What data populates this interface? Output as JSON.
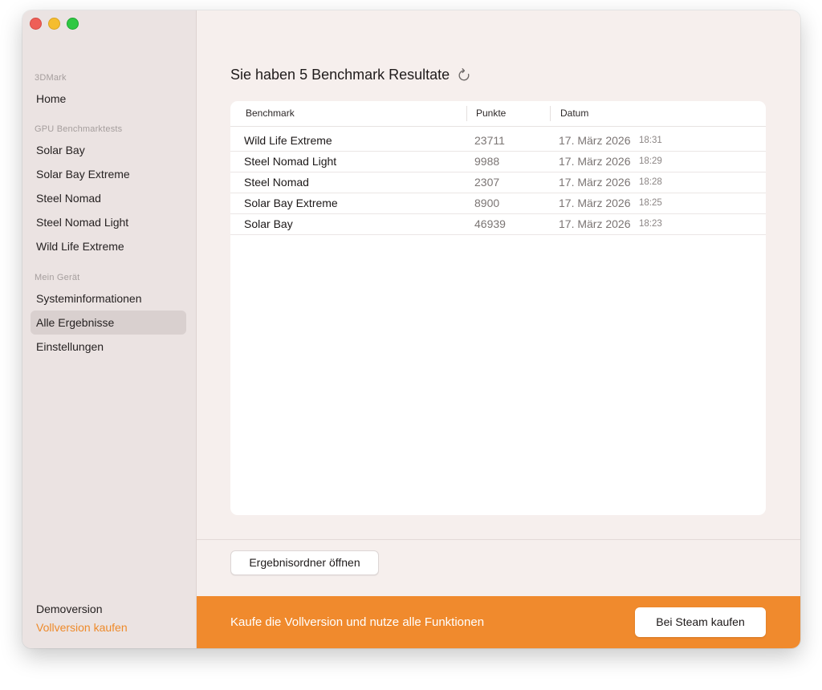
{
  "window": {
    "controls": [
      "close",
      "minimize",
      "zoom"
    ]
  },
  "sidebar": {
    "app_section": "3DMark",
    "home_label": "Home",
    "gpu_section": "GPU Benchmarktests",
    "gpu_items": [
      {
        "label": "Solar Bay"
      },
      {
        "label": "Solar Bay Extreme"
      },
      {
        "label": "Steel Nomad"
      },
      {
        "label": "Steel Nomad Light"
      },
      {
        "label": "Wild Life Extreme"
      }
    ],
    "device_section": "Mein Gerät",
    "device_items": [
      {
        "label": "Systeminformationen",
        "active": false
      },
      {
        "label": "Alle Ergebnisse",
        "active": true
      },
      {
        "label": "Einstellungen",
        "active": false
      }
    ],
    "demo_label": "Demoversion",
    "buy_label": "Vollversion kaufen"
  },
  "main": {
    "title": "Sie haben 5 Benchmark Resultate",
    "refresh_icon": "refresh-icon",
    "table": {
      "columns": [
        "Benchmark",
        "Punkte",
        "Datum"
      ],
      "rows": [
        {
          "benchmark": "Wild Life Extreme",
          "score": "23711",
          "date": "17. März 2026",
          "time": "18:31"
        },
        {
          "benchmark": "Steel Nomad Light",
          "score": "9988",
          "date": "17. März 2026",
          "time": "18:29"
        },
        {
          "benchmark": "Steel Nomad",
          "score": "2307",
          "date": "17. März 2026",
          "time": "18:28"
        },
        {
          "benchmark": "Solar Bay Extreme",
          "score": "8900",
          "date": "17. März 2026",
          "time": "18:25"
        },
        {
          "benchmark": "Solar Bay",
          "score": "46939",
          "date": "17. März 2026",
          "time": "18:23"
        }
      ]
    },
    "open_folder_label": "Ergebnisordner öffnen"
  },
  "banner": {
    "text": "Kaufe die Vollversion und nutze alle Funktionen",
    "button_label": "Bei Steam kaufen",
    "color": "#f08a2d"
  },
  "colors": {
    "accent_orange": "#f08a2d",
    "buy_link": "#ee8a2a",
    "close": "#ee5f57",
    "minimize": "#f5bd2f",
    "zoom": "#2fc843"
  }
}
